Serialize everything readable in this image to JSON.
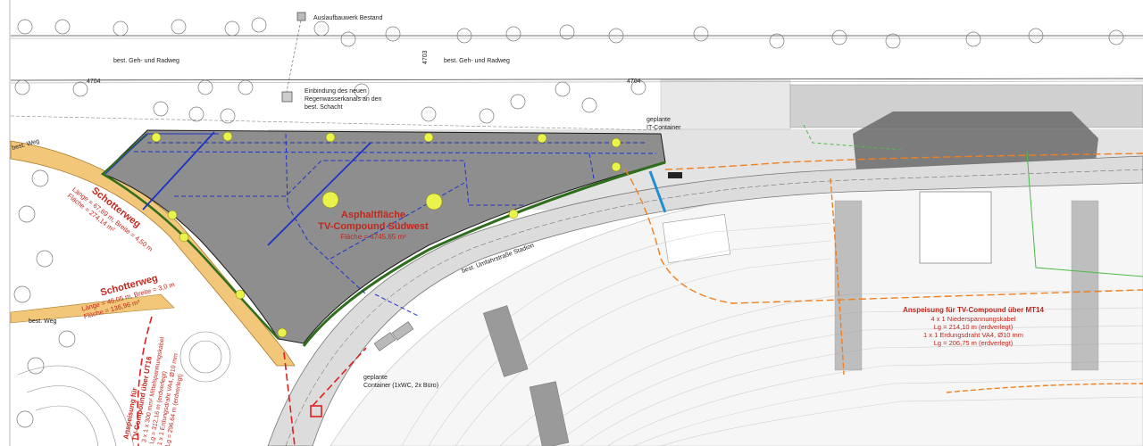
{
  "labels": {
    "outlet": "Auslaufbauwerk Bestand",
    "walk_left": "best. Geh- und Radweg",
    "walk_right": "best. Geh- und Radweg",
    "km_4704_a": "4704",
    "km_4704_b": "4704",
    "km_4703": "4703",
    "rain_note_1": "Einbindung des neuen",
    "rain_note_2": "Regenwasserkanals an den",
    "rain_note_3": "best. Schacht",
    "it_1": "geplante",
    "it_2": "IT-Container",
    "best_weg_top": "best. Weg",
    "best_weg_bottom": "best. Weg",
    "road": "best. Umfahrstraße Stadion",
    "container_1": "geplante",
    "container_2": "Container (1xWC, 2x Büro)"
  },
  "compound": {
    "title_1": "Asphaltfläche",
    "title_2": "TV-Compound Südwest",
    "area": "Fläche = 4745,65 m²"
  },
  "gravel_1": {
    "title": "Schotterweg",
    "line_1": "Länge = 67,89 m, Breite = 4,50 m",
    "line_2": "Fläche = 274,14 m²"
  },
  "gravel_2": {
    "title": "Schotterweg",
    "line_1": "Länge = 46,05 m, Breite = 3,0 m",
    "line_2": "Fläche = 136,96 m²"
  },
  "feed_mt14": {
    "title": "Anspeisung für TV-Compound über MT14",
    "line_1": "4 x 1 Niederspannungskabel",
    "line_2": "Lg = 214,10 m (erdverlegt)",
    "line_3": "1 x 1 Erdungsdraht VA4, Ø10 mm",
    "line_4": "Lg = 206,75 m (erdverlegt)"
  },
  "feed_ut16": {
    "title_1": "Anspeisung für",
    "title_2": "TV-Compound über UT16",
    "line_1": "3 x 1 x 300 mm² Mittelspannungskabel",
    "line_2": "Lg = 312,16 m (erdverlegt)",
    "line_3": "1 x 1 Erdungsdraht VA4, Ø10 mm",
    "line_4": "Lg = 296,64 m (erdverlegt)"
  },
  "colors": {
    "asphalt": "#8e8e8e",
    "gravel": "#f2c77a",
    "cable_blue": "#1e32c8",
    "cable_orange": "#f07f1e",
    "feed_red": "#e02020",
    "hedge_green": "#2f6e1c",
    "label_red": "#c0281e"
  }
}
